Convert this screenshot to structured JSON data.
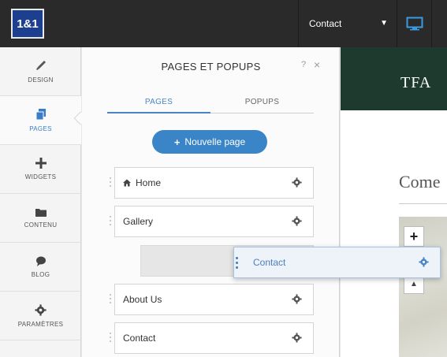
{
  "topbar": {
    "logo": "1&1",
    "page_select": "Contact"
  },
  "sidebar": {
    "items": [
      {
        "label": "DESIGN",
        "icon": "brush-icon"
      },
      {
        "label": "PAGES",
        "icon": "pages-icon",
        "active": true
      },
      {
        "label": "WIDGETS",
        "icon": "plus-icon"
      },
      {
        "label": "CONTENU",
        "icon": "folder-icon"
      },
      {
        "label": "BLOG",
        "icon": "speech-bubble-icon"
      },
      {
        "label": "PARAMÈTRES",
        "icon": "gear-icon"
      }
    ]
  },
  "panel": {
    "title": "PAGES ET POPUPS",
    "help": "?",
    "close": "×",
    "tabs": {
      "pages": "PAGES",
      "popups": "POPUPS"
    },
    "new_page_button": "Nouvelle page",
    "pages": [
      "Home",
      "Gallery",
      "About Us",
      "Contact"
    ],
    "dragged_page": "Contact"
  },
  "preview": {
    "site_logo": "TFA",
    "heading": "Come"
  },
  "colors": {
    "accent": "#3a85c7",
    "topbar": "#2a2a2a",
    "hero": "#1e3a2e"
  }
}
